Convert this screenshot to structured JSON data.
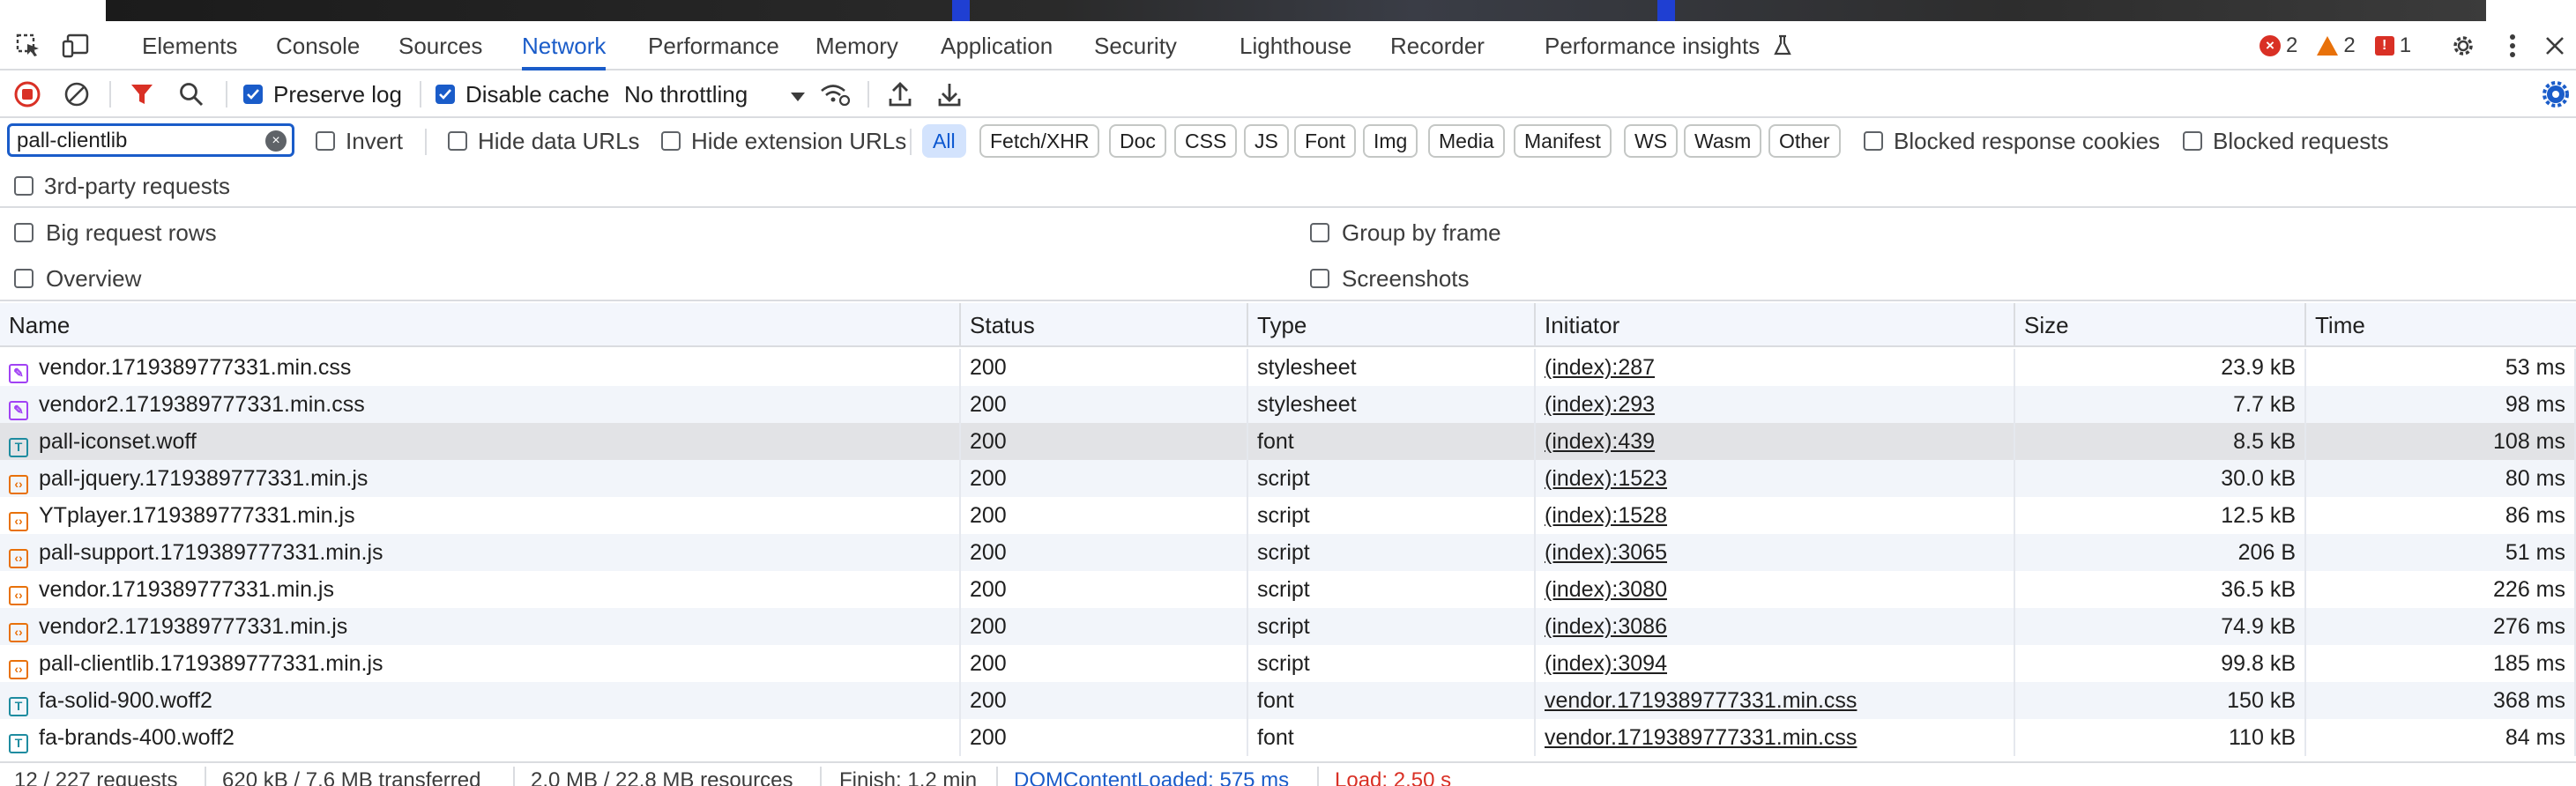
{
  "tabs": [
    "Elements",
    "Console",
    "Sources",
    "Network",
    "Performance",
    "Memory",
    "Application",
    "Security",
    "Lighthouse",
    "Recorder",
    "Performance insights"
  ],
  "badges": {
    "errors": "2",
    "warnings": "2",
    "issues": "1"
  },
  "toolbar": {
    "preserve_log": "Preserve log",
    "disable_cache": "Disable cache",
    "throttling": "No throttling"
  },
  "filter": {
    "search_value": "pall-clientlib",
    "invert": "Invert",
    "hide_data_urls": "Hide data URLs",
    "hide_extension_urls": "Hide extension URLs",
    "chips": [
      "All",
      "Fetch/XHR",
      "Doc",
      "CSS",
      "JS",
      "Font",
      "Img",
      "Media",
      "Manifest",
      "WS",
      "Wasm",
      "Other"
    ],
    "blocked_cookies": "Blocked response cookies",
    "blocked_requests": "Blocked requests",
    "third_party": "3rd-party requests"
  },
  "settings": {
    "big_rows": "Big request rows",
    "group_by_frame": "Group by frame",
    "overview": "Overview",
    "screenshots": "Screenshots"
  },
  "table": {
    "headers": [
      "Name",
      "Status",
      "Type",
      "Initiator",
      "Size",
      "Time"
    ],
    "rows": [
      {
        "name": "vendor.1719389777331.min.css",
        "status": "200",
        "type": "stylesheet",
        "initiator": "(index):287",
        "size": "23.9 kB",
        "time": "53 ms",
        "icon": "css"
      },
      {
        "name": "vendor2.1719389777331.min.css",
        "status": "200",
        "type": "stylesheet",
        "initiator": "(index):293",
        "size": "7.7 kB",
        "time": "98 ms",
        "icon": "css"
      },
      {
        "name": "pall-iconset.woff",
        "status": "200",
        "type": "font",
        "initiator": "(index):439",
        "size": "8.5 kB",
        "time": "108 ms",
        "icon": "font"
      },
      {
        "name": "pall-jquery.1719389777331.min.js",
        "status": "200",
        "type": "script",
        "initiator": "(index):1523",
        "size": "30.0 kB",
        "time": "80 ms",
        "icon": "js"
      },
      {
        "name": "YTplayer.1719389777331.min.js",
        "status": "200",
        "type": "script",
        "initiator": "(index):1528",
        "size": "12.5 kB",
        "time": "86 ms",
        "icon": "js"
      },
      {
        "name": "pall-support.1719389777331.min.js",
        "status": "200",
        "type": "script",
        "initiator": "(index):3065",
        "size": "206 B",
        "time": "51 ms",
        "icon": "js"
      },
      {
        "name": "vendor.1719389777331.min.js",
        "status": "200",
        "type": "script",
        "initiator": "(index):3080",
        "size": "36.5 kB",
        "time": "226 ms",
        "icon": "js"
      },
      {
        "name": "vendor2.1719389777331.min.js",
        "status": "200",
        "type": "script",
        "initiator": "(index):3086",
        "size": "74.9 kB",
        "time": "276 ms",
        "icon": "js"
      },
      {
        "name": "pall-clientlib.1719389777331.min.js",
        "status": "200",
        "type": "script",
        "initiator": "(index):3094",
        "size": "99.8 kB",
        "time": "185 ms",
        "icon": "js"
      },
      {
        "name": "fa-solid-900.woff2",
        "status": "200",
        "type": "font",
        "initiator": "vendor.1719389777331.min.css",
        "size": "150 kB",
        "time": "368 ms",
        "icon": "font"
      },
      {
        "name": "fa-brands-400.woff2",
        "status": "200",
        "type": "font",
        "initiator": "vendor.1719389777331.min.css",
        "size": "110 kB",
        "time": "84 ms",
        "icon": "font"
      }
    ]
  },
  "statusbar": {
    "requests": "12 / 227 requests",
    "transferred": "620 kB / 7.6 MB transferred",
    "resources": "2.0 MB / 22.8 MB resources",
    "finish": "Finish: 1.2 min",
    "domcontent": "DOMContentLoaded: 575 ms",
    "load": "Load: 2.50 s"
  }
}
